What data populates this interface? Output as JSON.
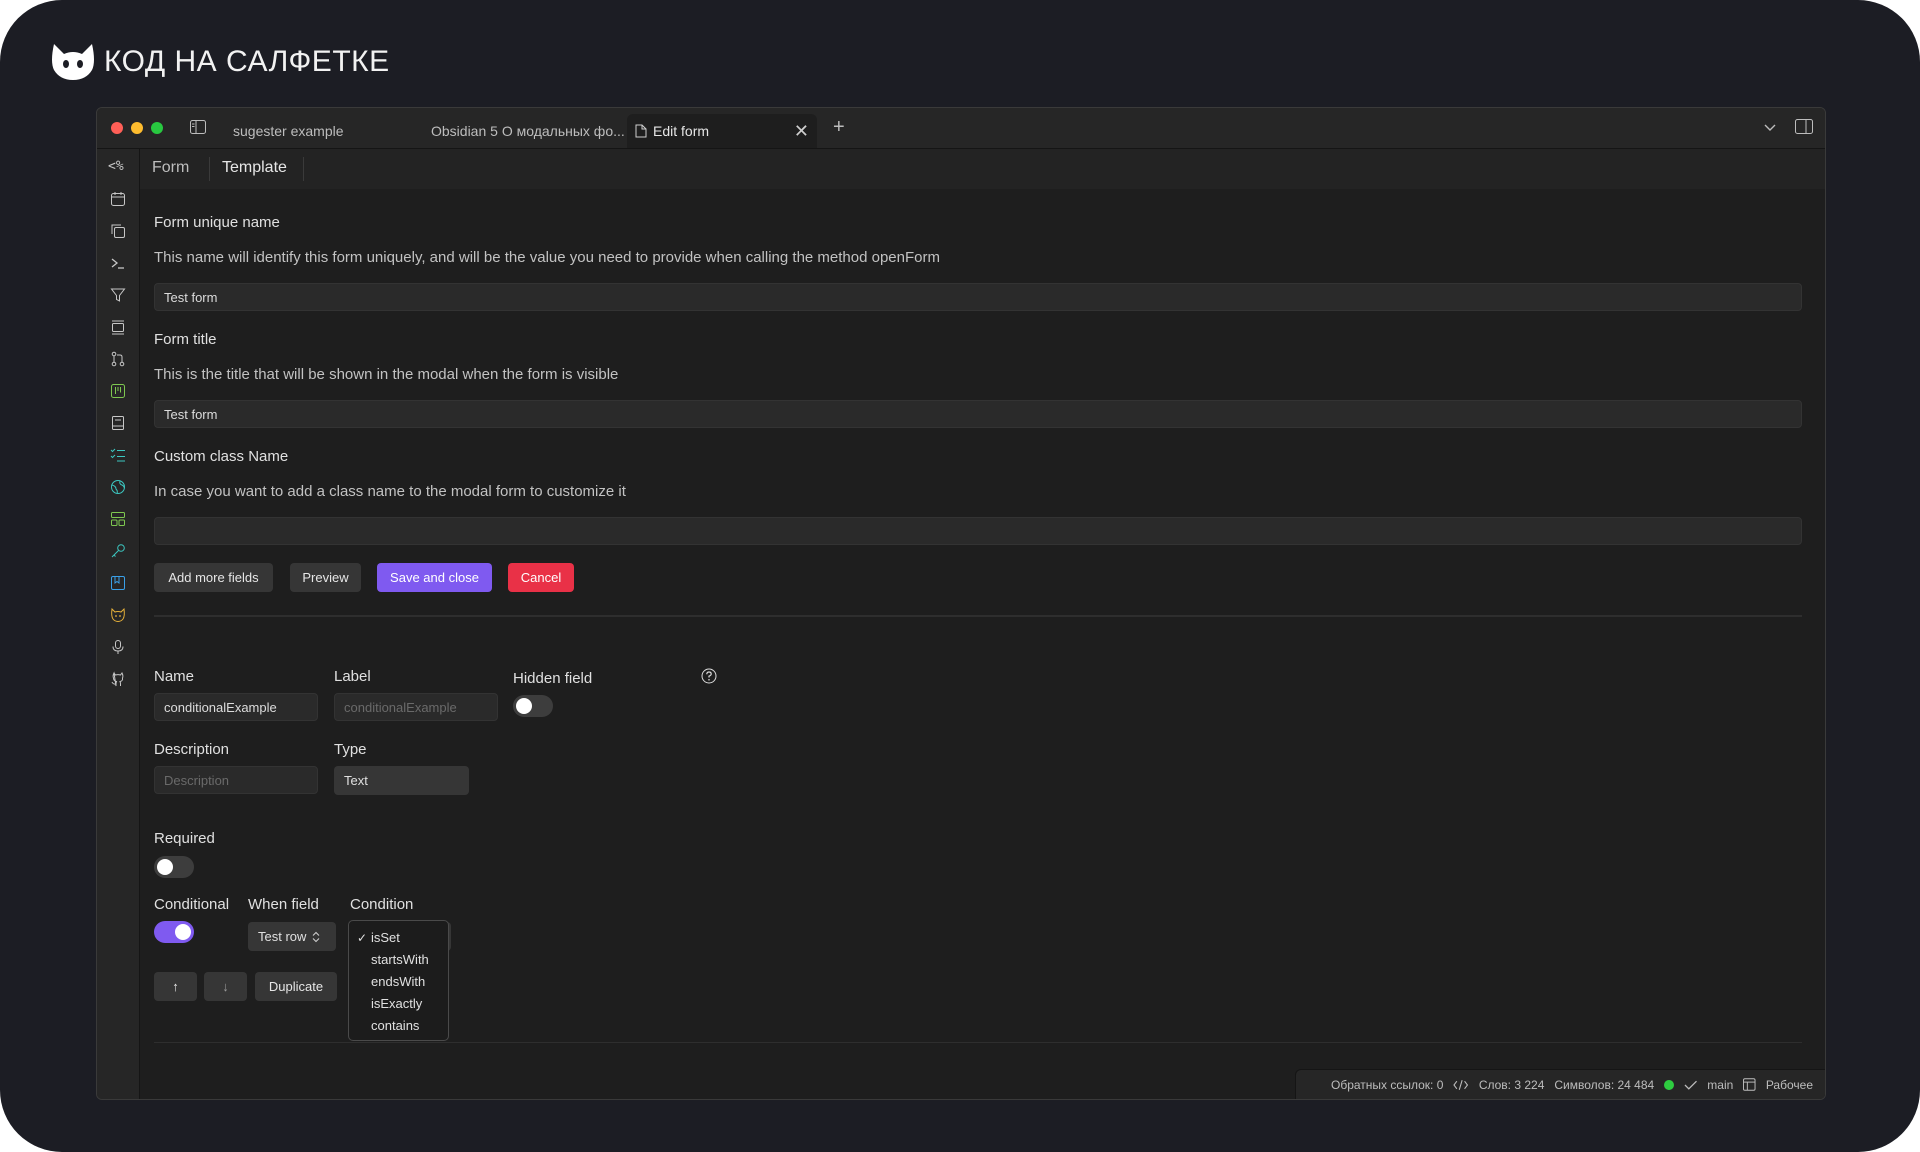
{
  "brand": {
    "text": "КОД НА САЛФЕТКЕ",
    "icon": "cat-icon"
  },
  "window": {
    "tabs": [
      {
        "label": "sugester example"
      },
      {
        "label": "Obsidian 5 О модальных фо..."
      },
      {
        "label": "Edit form"
      }
    ],
    "new_tab": "+",
    "close": "✕"
  },
  "ribbon": {
    "command_icon_text": "<%"
  },
  "subtabs": {
    "form": "Form",
    "template": "Template"
  },
  "form": {
    "unique_name_label": "Form unique name",
    "unique_name_desc": "This name will identify this form uniquely, and will be the value you need to provide when calling the method openForm",
    "unique_name_value": "Test form",
    "title_label": "Form title",
    "title_desc": "This is the title that will be shown in the modal when the form is visible",
    "title_value": "Test form",
    "class_label": "Custom class Name",
    "class_desc": "In case you want to add a class name to the modal form to customize it",
    "class_value": ""
  },
  "actions": {
    "add_more": "Add more fields",
    "preview": "Preview",
    "save": "Save and close",
    "cancel": "Cancel"
  },
  "field": {
    "name_label": "Name",
    "name_value": "conditionalExample",
    "label_label": "Label",
    "label_placeholder": "conditionalExample",
    "hidden_label": "Hidden field",
    "hidden_on": false,
    "description_label": "Description",
    "description_placeholder": "Description",
    "type_label": "Type",
    "type_value": "Text",
    "required_label": "Required",
    "required_on": false,
    "conditional_label": "Conditional",
    "conditional_on": true,
    "when_field_label": "When field",
    "when_field_value": "Test row",
    "condition_label": "Condition",
    "condition_options": [
      "isSet",
      "startsWith",
      "endsWith",
      "isExactly",
      "contains"
    ],
    "condition_selected": "isSet",
    "check_mark": "✓",
    "up_arrow": "↑",
    "down_arrow": "↓",
    "duplicate": "Duplicate"
  },
  "status": {
    "backlinks": "Обратных ссылок: 0",
    "words": "Слов: 3 224",
    "chars": "Символов: 24 484",
    "branch": "main",
    "workspace": "Рабочее"
  },
  "colors": {
    "accent": "#7f5af0",
    "danger": "#e93147",
    "sync": "#2ecc40"
  }
}
